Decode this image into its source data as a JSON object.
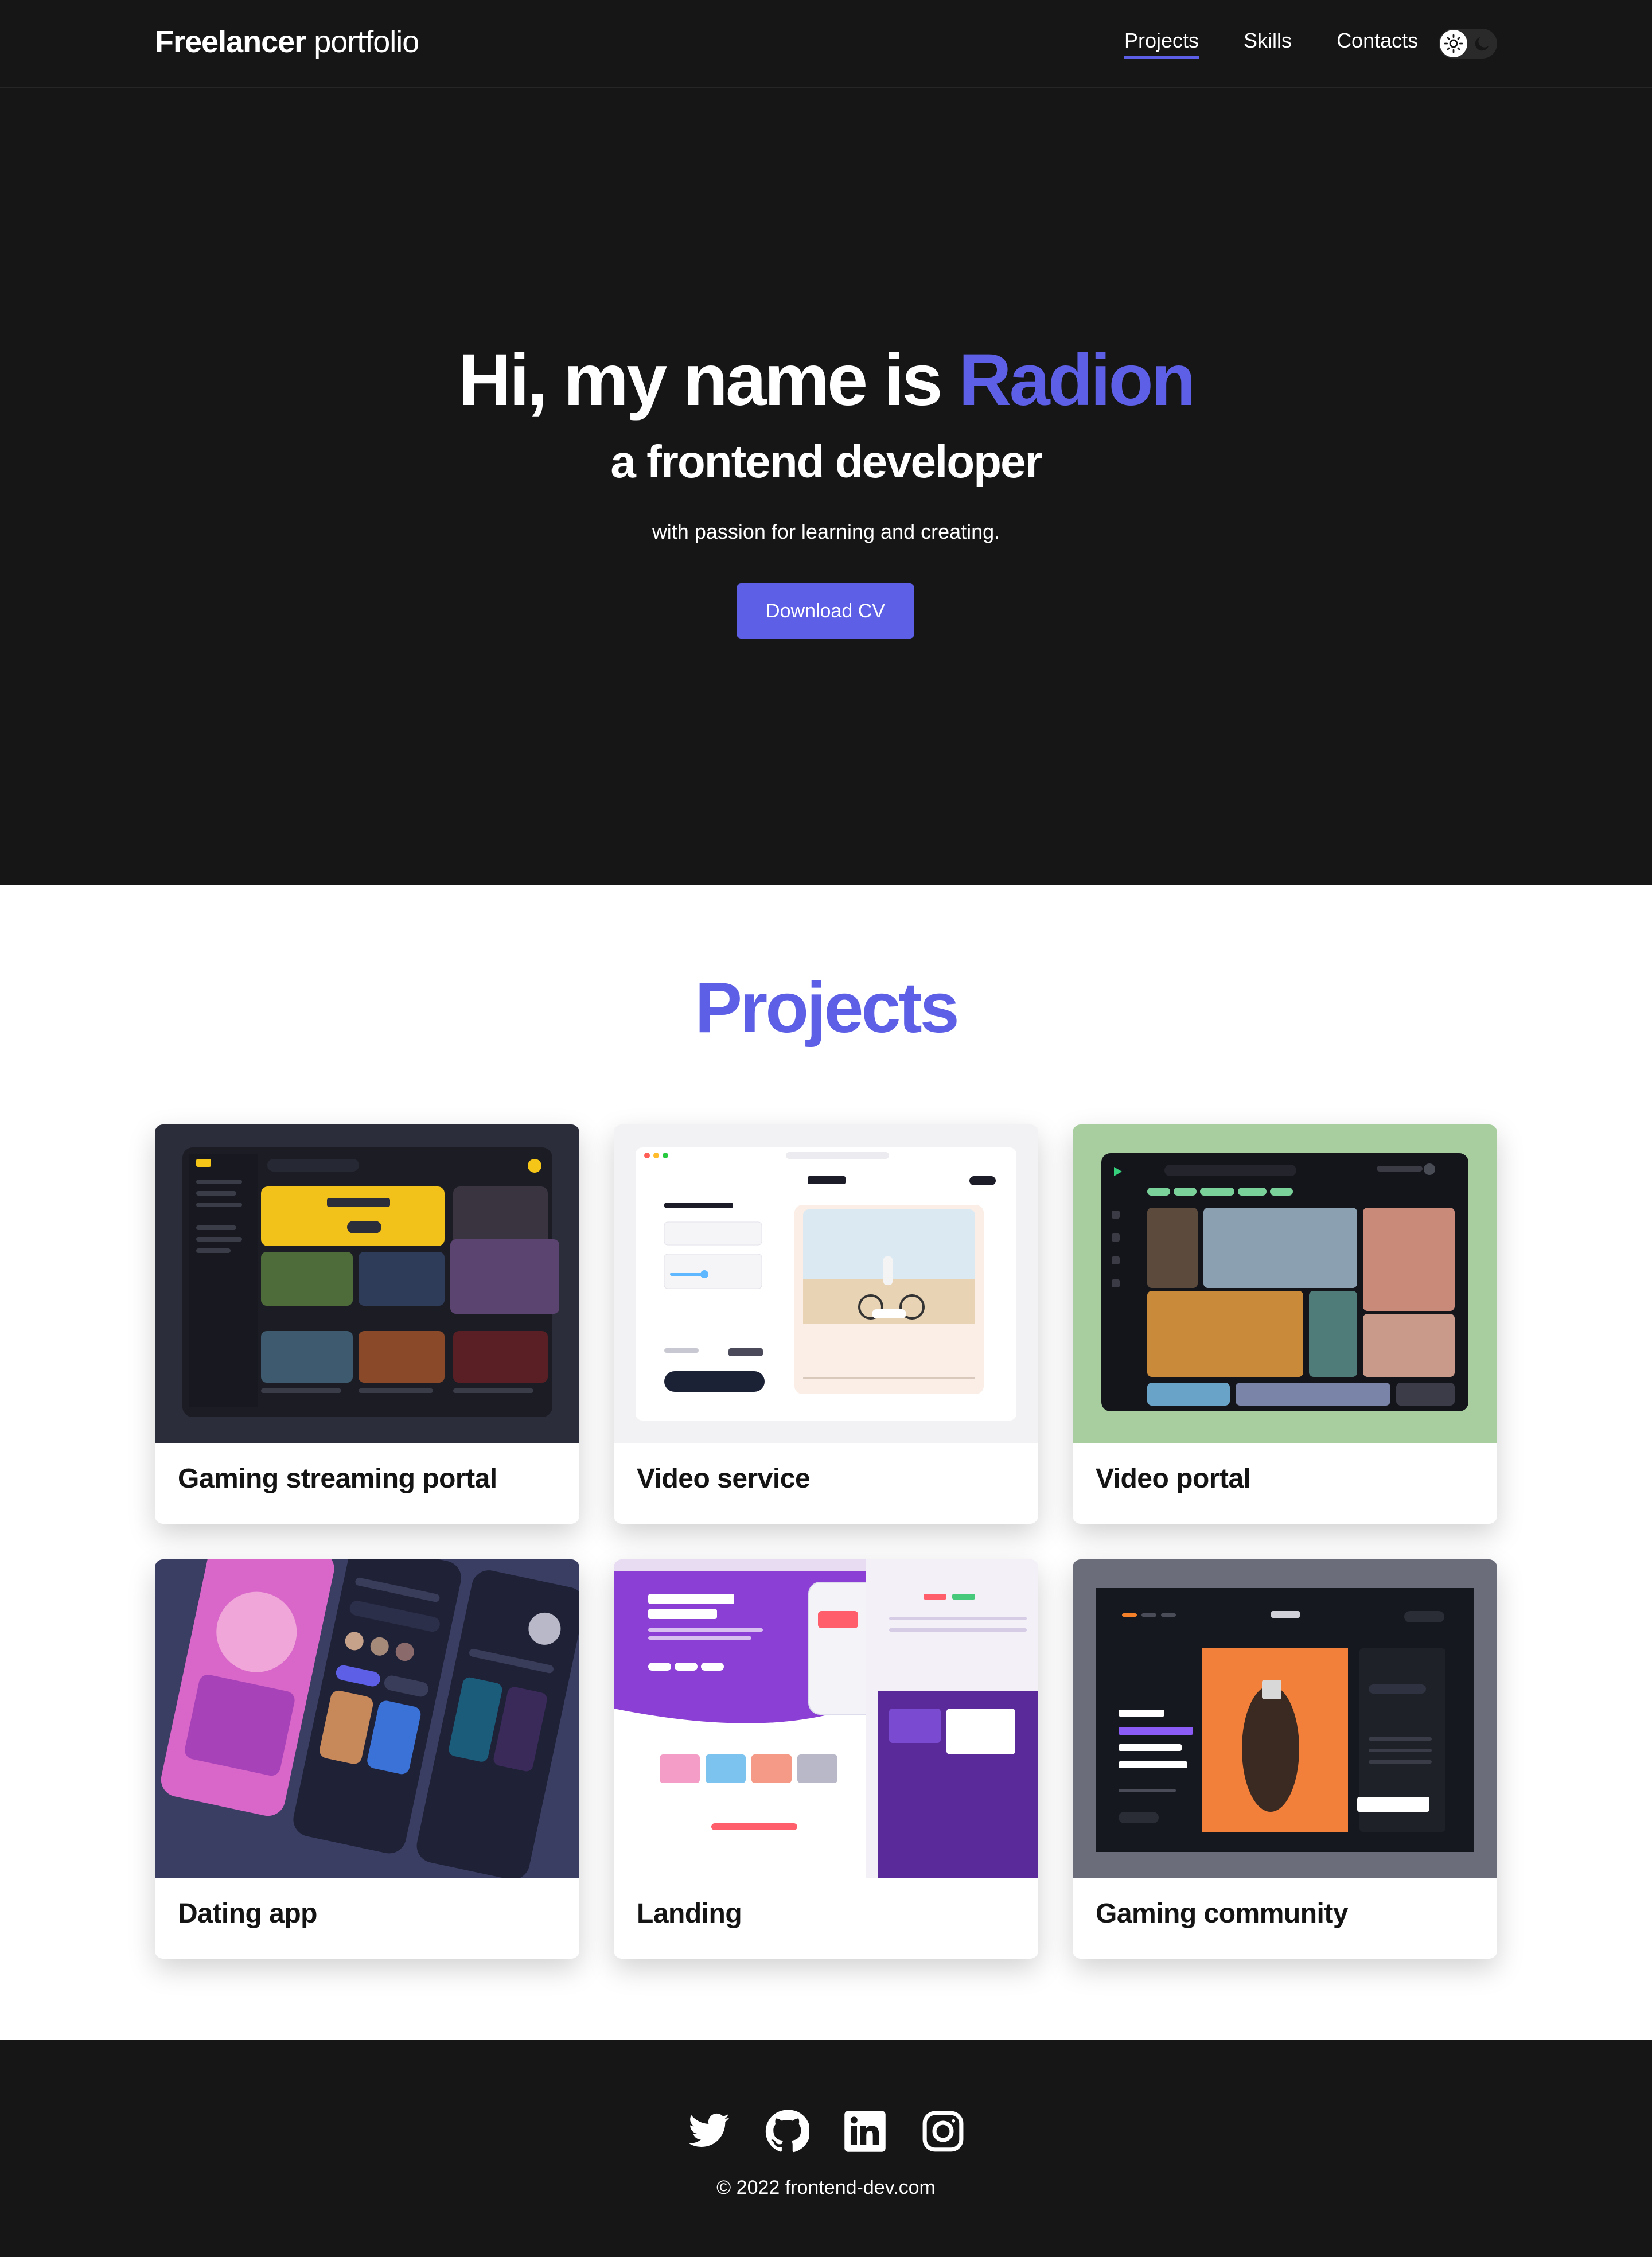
{
  "header": {
    "logo_bold": "Freelancer",
    "logo_light": "portfolio",
    "nav": [
      {
        "label": "Projects",
        "active": true
      },
      {
        "label": "Skills",
        "active": false
      },
      {
        "label": "Contacts",
        "active": false
      }
    ],
    "theme_toggle": {
      "icons": [
        "sun-icon",
        "moon-icon"
      ],
      "mode": "dark"
    }
  },
  "hero": {
    "title_prefix": "Hi, my name is",
    "name": "Radion",
    "subtitle": "a frontend developer",
    "text": "with passion for learning and creating.",
    "cta_label": "Download CV"
  },
  "projects": {
    "title": "Projects",
    "items": [
      {
        "title": "Gaming streaming portal"
      },
      {
        "title": "Video service"
      },
      {
        "title": "Video portal"
      },
      {
        "title": "Dating app"
      },
      {
        "title": "Landing"
      },
      {
        "title": "Gaming community"
      }
    ]
  },
  "footer": {
    "socials": [
      "twitter-icon",
      "github-icon",
      "linkedin-icon",
      "instagram-icon"
    ],
    "copyright": "© 2022 frontend-dev.com"
  },
  "colors": {
    "accent": "#5d5fe6",
    "dark_bg": "#161616",
    "light_bg": "#ffffff"
  }
}
